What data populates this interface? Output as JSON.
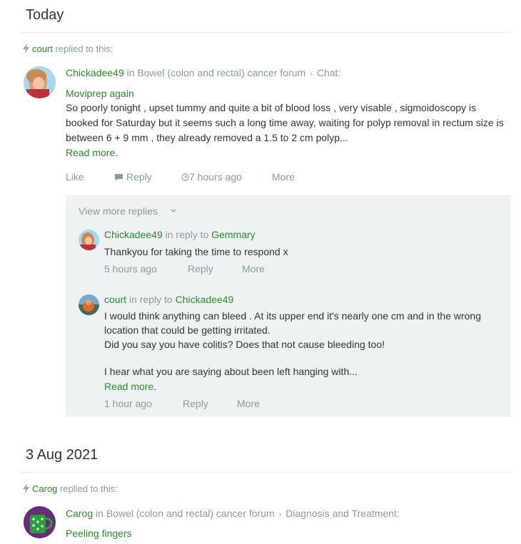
{
  "sections": [
    {
      "date": "Today"
    },
    {
      "date": "3 Aug 2021"
    }
  ],
  "post1": {
    "activity_user": "court",
    "activity_text": "replied to this:",
    "author": "Chickadee49",
    "in_text": "in",
    "forum": "Bowel (colon and rectal) cancer forum",
    "subforum": "Chat:",
    "title": "Moviprep again",
    "body": "So poorly tonight , upset tummy and quite a bit of blood loss , very visable , sigmoidoscopy is booked for Saturday but it seems such a long time away,  waiting for polyp removal in rectum size is between 6 + 9 mm , they already removed a 1.5 to 2 cm polyp...",
    "read_more": "Read more.",
    "actions": {
      "like": "Like",
      "reply": "Reply",
      "time": "7 hours ago",
      "more": "More"
    }
  },
  "replies": {
    "view_more": "View more replies",
    "items": [
      {
        "author": "Chickadee49",
        "in_reply_to": "in reply to",
        "target": "Gemmary",
        "lines": [
          "Thankyou for taking the time to respond x"
        ],
        "time": "5 hours ago",
        "reply": "Reply",
        "more": "More"
      },
      {
        "author": "court",
        "in_reply_to": "in reply to",
        "target": "Chickadee49",
        "lines": [
          "I would think anything can bleed . At its upper end it's nearly one cm and in the wrong location that could be getting irritated.",
          "Did you say you have colitis? Does that not cause bleeding too!",
          "I hear what you are saying about been left hanging with..."
        ],
        "read_more": "Read more.",
        "time": "1 hour ago",
        "reply": "Reply",
        "more": "More"
      }
    ]
  },
  "post2": {
    "activity_user": "Carog",
    "activity_text": "replied to this:",
    "author": "Carog",
    "in_text": "in",
    "forum": "Bowel (colon and rectal) cancer forum",
    "subforum": "Diagnosis and Treatment:",
    "title": "Peeling fingers"
  },
  "icons": {
    "bolt": "lightning-icon",
    "chevron_right": "chevron-right-icon",
    "chevron_down": "chevron-down-icon",
    "comment": "comment-icon",
    "clock": "clock-icon"
  },
  "colors": {
    "accent_green": "#2a8a2a",
    "muted": "#8a9aa0",
    "reply_bg": "#eef2f3"
  }
}
